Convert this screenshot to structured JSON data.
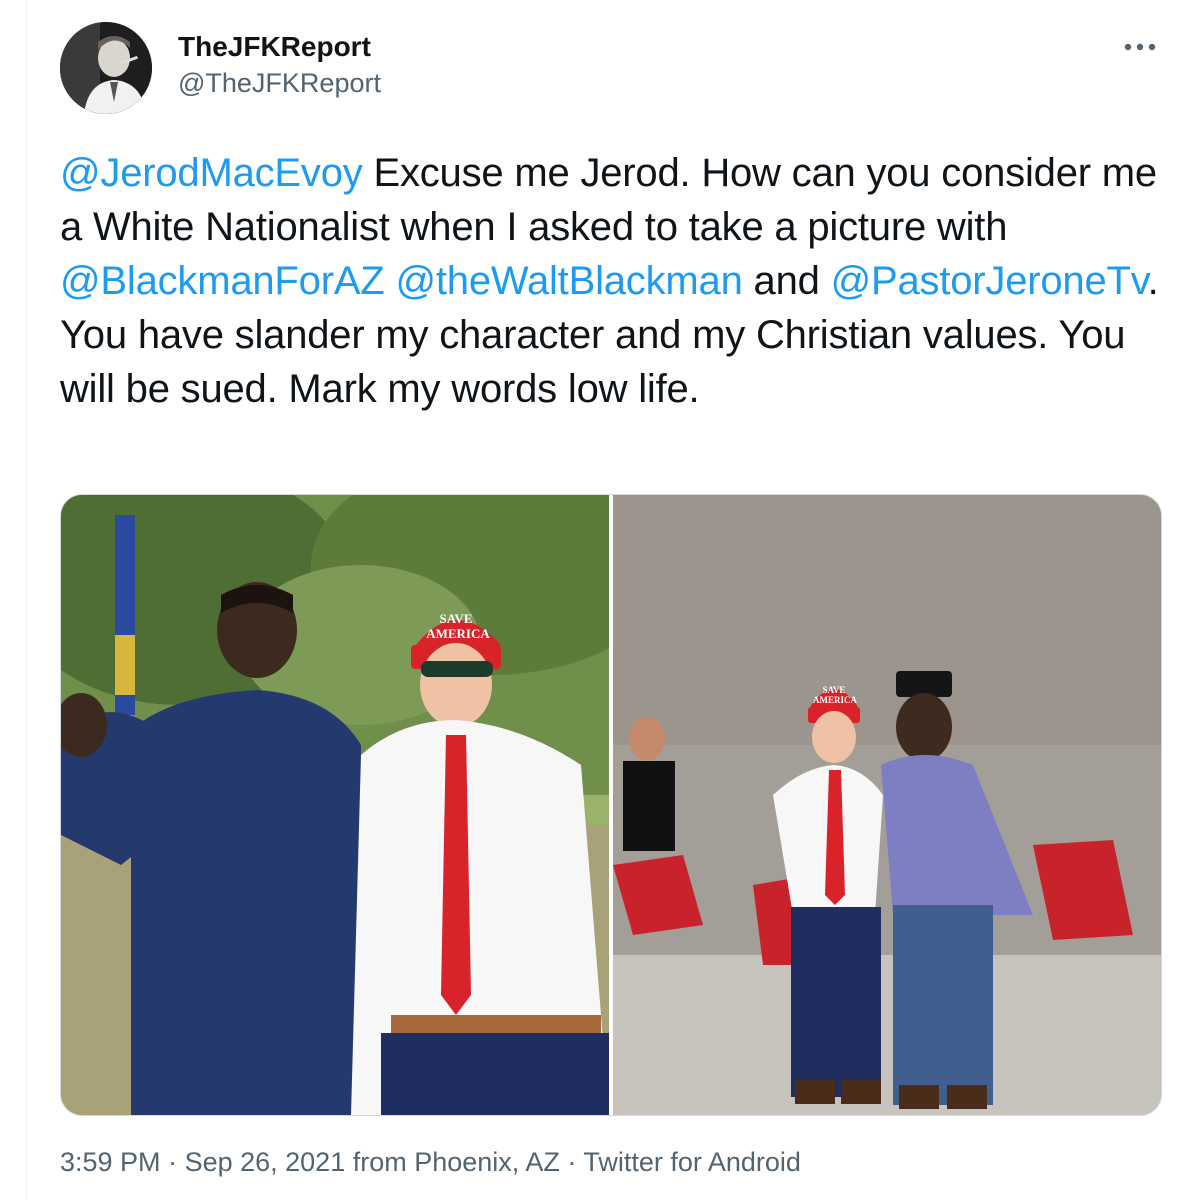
{
  "author": {
    "display_name": "TheJFKReport",
    "handle": "@TheJFKReport",
    "avatar": "jfk-portrait-avatar"
  },
  "more_icon": "ellipsis-icon",
  "tweet": {
    "segments": [
      {
        "type": "mention",
        "text": "@JerodMacEvoy"
      },
      {
        "type": "text",
        "text": " Excuse me Jerod. How can you consider me a White Nationalist when I asked to take a picture with "
      },
      {
        "type": "mention",
        "text": "@BlackmanForAZ"
      },
      {
        "type": "text",
        "text": " "
      },
      {
        "type": "mention",
        "text": "@theWaltBlackman"
      },
      {
        "type": "text",
        "text": " and "
      },
      {
        "type": "mention",
        "text": "@PastorJeroneTv"
      },
      {
        "type": "text",
        "text": ". You have slander my character and my Christian values. You will be sued. Mark my words low life."
      }
    ]
  },
  "media": [
    {
      "hat_text": [
        "SAVE",
        "AMERICA"
      ]
    },
    {
      "hat_text": [
        "SAVE",
        "AMERICA"
      ]
    }
  ],
  "meta": {
    "time": "3:59 PM",
    "sep1": " · ",
    "date": "Sep 26, 2021",
    "location_prefix": " from ",
    "location": "Phoenix, AZ",
    "sep2": " · ",
    "source": "Twitter for Android"
  },
  "colors": {
    "link": "#1d9bf0",
    "secondary_text": "#536471",
    "hat_red": "#d8232a"
  }
}
